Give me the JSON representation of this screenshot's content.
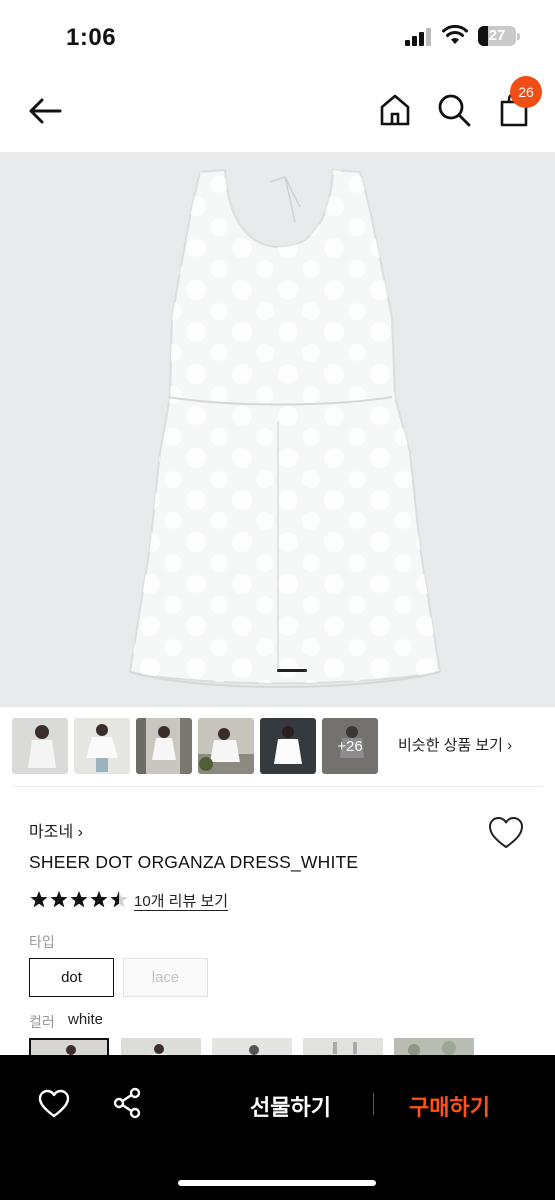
{
  "status": {
    "time": "1:06",
    "battery": "27",
    "battery_level": 0.27
  },
  "nav": {
    "cart_count": "26"
  },
  "gallery": {
    "more_label": "+26",
    "similar_label": "비슷한 상품 보기 ›"
  },
  "product": {
    "brand": "마조네 ›",
    "name": "SHEER DOT ORGANZA DRESS_WHITE",
    "rating": 4.5,
    "review_label": "10개 리뷰 보기"
  },
  "options": {
    "type_label": "타입",
    "types": [
      "dot",
      "lace"
    ],
    "selected_type": "dot",
    "color_label": "컬러",
    "color_value": "white"
  },
  "bottom": {
    "gift_label": "선물하기",
    "buy_label": "구매하기"
  },
  "colors": {
    "accent": "#f04e14",
    "buy": "#ff5214",
    "hero_bg": "#e8eaeb"
  },
  "icons": [
    "back-arrow-icon",
    "home-icon",
    "search-icon",
    "shopping-bag-icon",
    "heart-icon",
    "share-icon",
    "star-icon"
  ]
}
